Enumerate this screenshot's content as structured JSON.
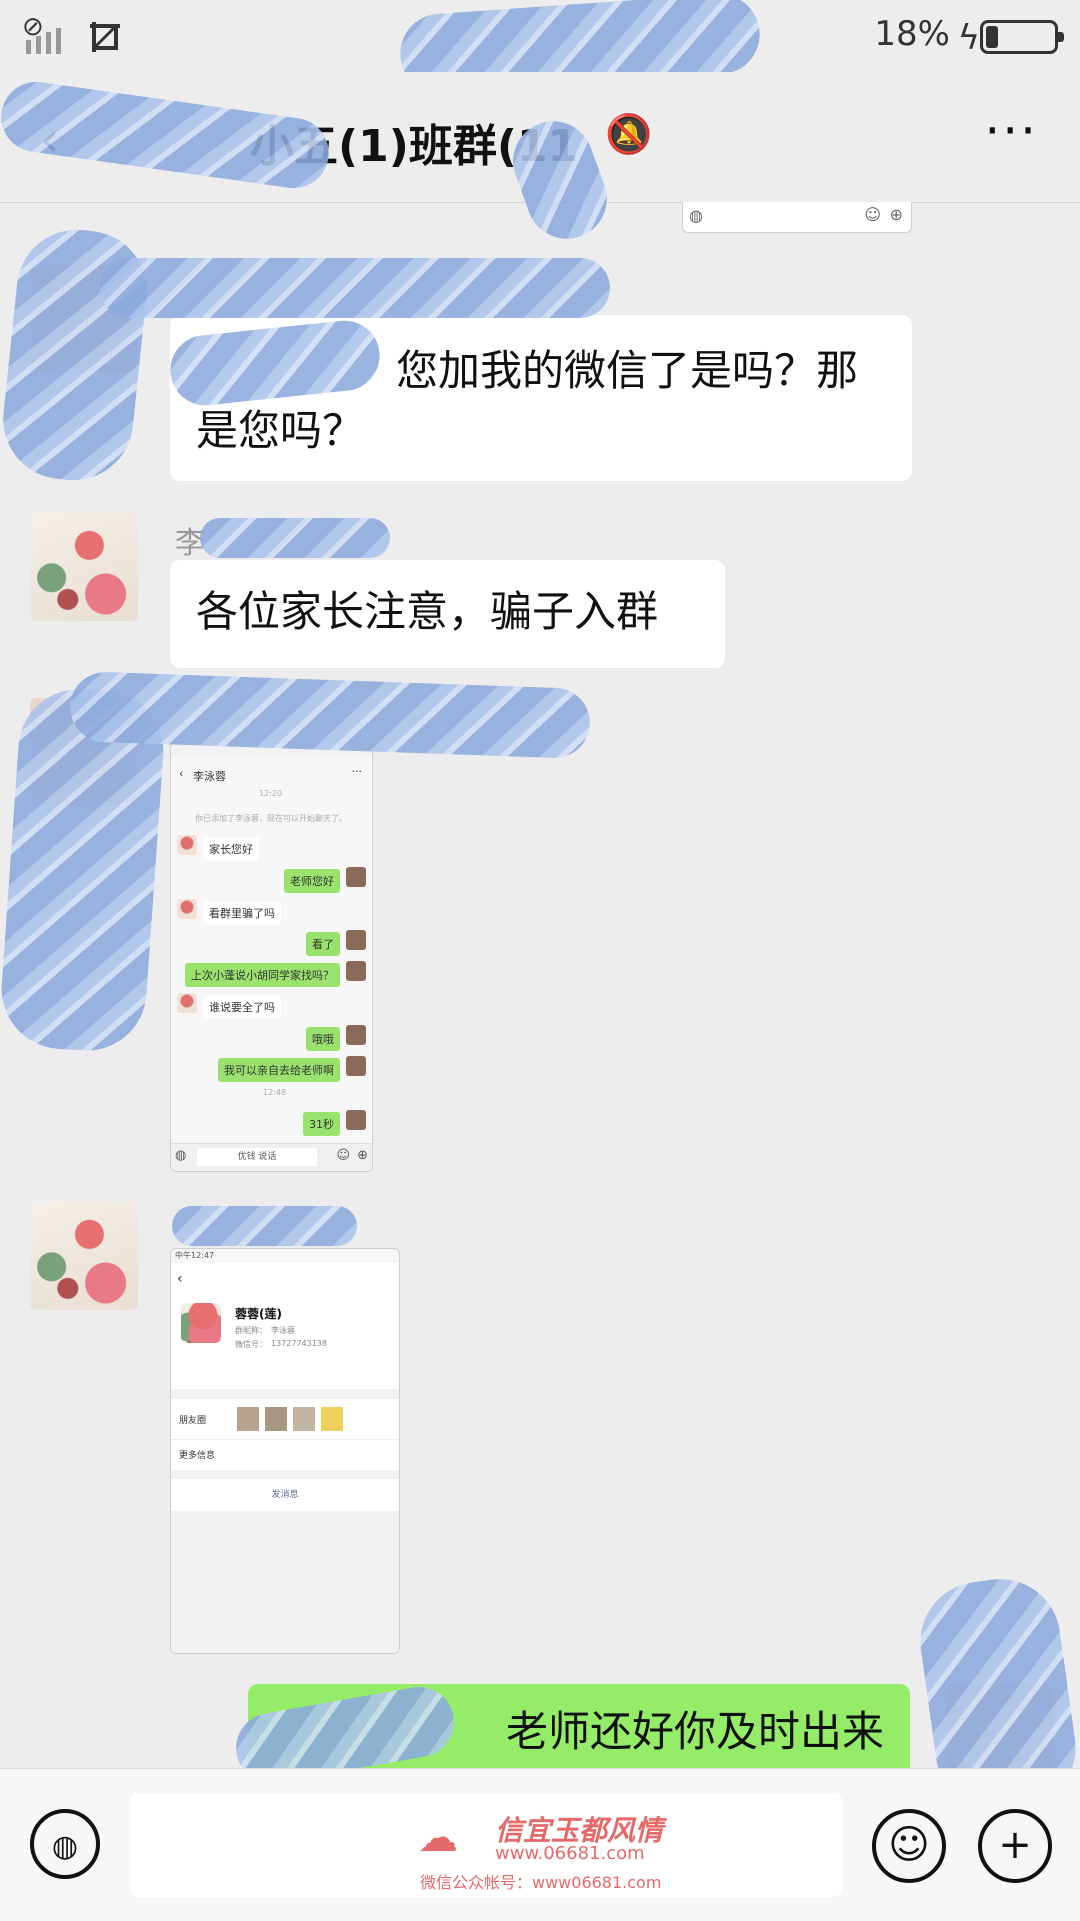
{
  "status_bar": {
    "battery_percent": "18%",
    "battery_level": 0.18,
    "icons": [
      "no-sim-icon",
      "signal-icon",
      "screenshot-icon",
      "charging-bolt-icon",
      "battery-icon"
    ]
  },
  "title_bar": {
    "title": "小五(1)班群(11",
    "back_glyph": "‹",
    "more_glyph": "···"
  },
  "messages": [
    {
      "type": "text",
      "text_visible": "您加我的微信了是吗？那是您吗？",
      "line1": "您加我的微信了是吗？那",
      "line2": "是您吗？"
    },
    {
      "type": "text",
      "sender": "李",
      "text": "各位家长注意，骗子入群"
    },
    {
      "type": "image",
      "caption": "chat screenshot"
    },
    {
      "type": "image",
      "caption": "profile screenshot"
    },
    {
      "type": "text_outgoing",
      "text": "老师还好你及时出来"
    }
  ],
  "shot1": {
    "title": "李泳蓉",
    "time1": "12:20",
    "notice": "你已添加了李泳蓉，现在可以开始聊天了。",
    "rows": [
      {
        "side": "left",
        "text": "家长您好"
      },
      {
        "side": "right",
        "text": "老师您好"
      },
      {
        "side": "left",
        "text": "看群里骗了吗"
      },
      {
        "side": "right",
        "text": "看了"
      },
      {
        "side": "right",
        "text": "上次小蓬说小胡同学家找吗？"
      },
      {
        "side": "left",
        "text": "谁说要全了吗"
      },
      {
        "side": "right",
        "text": "哦哦"
      },
      {
        "side": "right",
        "text": "我可以亲自去给老师啊"
      },
      {
        "side": "right",
        "text": "31秒"
      }
    ],
    "time2": "12:48",
    "input_text": "优钱 说话"
  },
  "shot2": {
    "status_time": "中午12:47",
    "name": "蓉蓉(莲)",
    "nickname_label": "群昵称：",
    "nickname": "李泳蓉",
    "wechat_label": "微信号：",
    "wechat_id": "13727743138",
    "moments_label": "朋友圈",
    "more_info": "更多信息",
    "send_msg": "发消息"
  },
  "input_bar": {
    "watermark_title": "信宜玉都风情",
    "watermark_url": "www.06681.com",
    "watermark_sub": "微信公众帐号：www06681.com"
  }
}
